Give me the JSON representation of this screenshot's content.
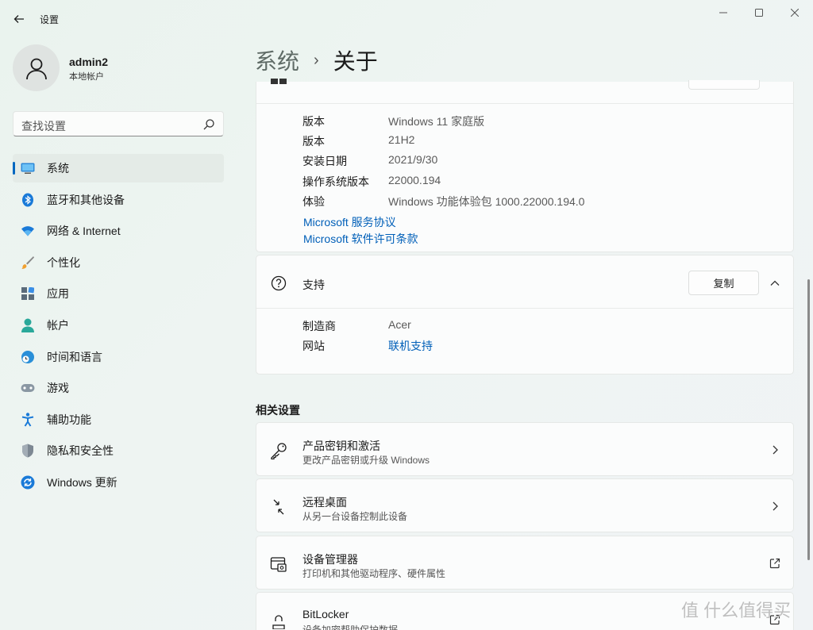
{
  "titlebar": {
    "app_title": "设置"
  },
  "profile": {
    "username": "admin2",
    "account_type": "本地帐户"
  },
  "search": {
    "placeholder": "查找设置"
  },
  "sidebar": {
    "items": [
      {
        "label": "系统",
        "icon": "system-icon",
        "active": true
      },
      {
        "label": "蓝牙和其他设备",
        "icon": "bluetooth-icon"
      },
      {
        "label": "网络 & Internet",
        "icon": "wifi-icon"
      },
      {
        "label": "个性化",
        "icon": "brush-icon"
      },
      {
        "label": "应用",
        "icon": "apps-icon"
      },
      {
        "label": "帐户",
        "icon": "account-icon"
      },
      {
        "label": "时间和语言",
        "icon": "globe-clock-icon"
      },
      {
        "label": "游戏",
        "icon": "gamepad-icon"
      },
      {
        "label": "辅助功能",
        "icon": "accessibility-icon"
      },
      {
        "label": "隐私和安全性",
        "icon": "shield-icon"
      },
      {
        "label": "Windows 更新",
        "icon": "update-icon"
      }
    ]
  },
  "breadcrumb": {
    "parent": "系统",
    "separator": "›",
    "current": "关于"
  },
  "windows_spec": {
    "rows": [
      {
        "key": "版本",
        "value": "Windows 11 家庭版"
      },
      {
        "key": "版本",
        "value": "21H2"
      },
      {
        "key": "安装日期",
        "value": "2021/9/30"
      },
      {
        "key": "操作系统版本",
        "value": "22000.194"
      },
      {
        "key": "体验",
        "value": "Windows 功能体验包 1000.22000.194.0"
      }
    ],
    "links": [
      "Microsoft 服务协议",
      "Microsoft 软件许可条款"
    ]
  },
  "support": {
    "title": "支持",
    "copy_label": "复制",
    "rows": [
      {
        "key": "制造商",
        "value": "Acer"
      },
      {
        "key": "网站",
        "value": "联机支持"
      }
    ]
  },
  "related": {
    "title": "相关设置",
    "items": [
      {
        "title": "产品密钥和激活",
        "subtitle": "更改产品密钥或升级 Windows",
        "icon": "key-icon",
        "action": "chevron"
      },
      {
        "title": "远程桌面",
        "subtitle": "从另一台设备控制此设备",
        "icon": "remote-desktop-icon",
        "action": "chevron"
      },
      {
        "title": "设备管理器",
        "subtitle": "打印机和其他驱动程序、硬件属性",
        "icon": "device-manager-icon",
        "action": "external"
      },
      {
        "title": "BitLocker",
        "subtitle": "设备加密帮助保护数据",
        "icon": "lock-icon",
        "action": "external"
      }
    ]
  },
  "watermark": "值 什么值得买",
  "colors": {
    "accent": "#0067c0",
    "link": "#005fb8"
  }
}
